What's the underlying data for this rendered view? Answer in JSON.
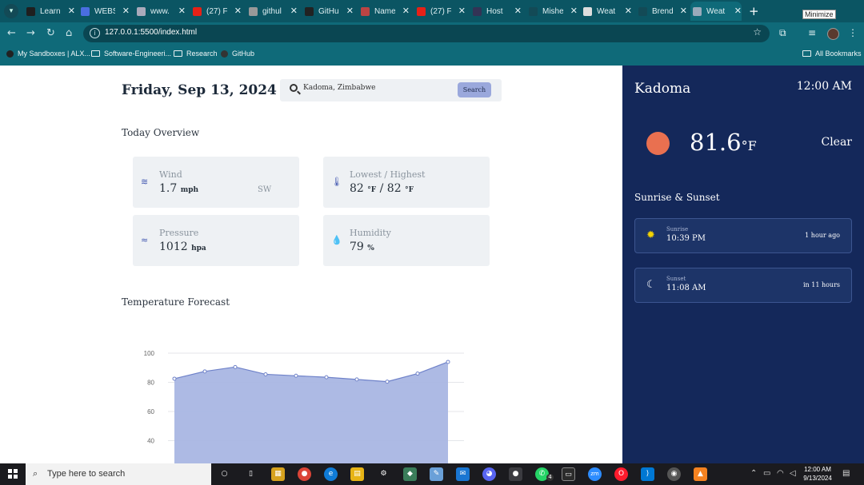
{
  "browser": {
    "tabs": [
      {
        "title": "Learn",
        "color": "#1f1f1f"
      },
      {
        "title": "WEBS",
        "color": "#4a6ee0"
      },
      {
        "title": "www.",
        "color": "#aab"
      },
      {
        "title": "(27) F",
        "color": "#e62117"
      },
      {
        "title": "githul",
        "color": "#999"
      },
      {
        "title": "GitHu",
        "color": "#222"
      },
      {
        "title": "Name",
        "color": "#b44"
      },
      {
        "title": "(27) F",
        "color": "#e62117"
      },
      {
        "title": "Host",
        "color": "#335"
      },
      {
        "title": "Mishe",
        "color": "#134a56"
      },
      {
        "title": "Weat",
        "color": "#ddd"
      },
      {
        "title": "Brend",
        "color": "#134a56"
      },
      {
        "title": "Weat",
        "color": "#9ab"
      }
    ],
    "tooltip": "Minimize",
    "url": "127.0.0.1:5500/index.html",
    "bookmarks": [
      "My Sandboxes | ALX...",
      "Software-Engineeri...",
      "Research",
      "GitHub"
    ],
    "all_bookmarks": "All Bookmarks"
  },
  "main": {
    "date": "Friday, Sep 13, 2024",
    "search": {
      "value": "Kadoma, Zimbabwe",
      "button": "Search"
    },
    "overview_title": "Today Overview",
    "cards": {
      "wind": {
        "label": "Wind",
        "value": "1.7",
        "unit": "mph",
        "direction": "SW"
      },
      "lowhigh": {
        "label": "Lowest / Highest",
        "low": "82",
        "high": "82",
        "unit": "°F"
      },
      "pressure": {
        "label": "Pressure",
        "value": "1012",
        "unit": "hpa"
      },
      "humidity": {
        "label": "Humidity",
        "value": "79",
        "unit": "%"
      }
    },
    "forecast_title": "Temperature Forecast"
  },
  "chart_data": {
    "type": "area",
    "x": [
      1,
      2,
      3,
      4,
      5,
      6,
      7,
      8,
      9,
      10
    ],
    "values": [
      82.5,
      87.5,
      90.5,
      85.5,
      84.5,
      83.5,
      82,
      80.5,
      86,
      94
    ],
    "yticks": [
      40,
      60,
      80,
      100
    ],
    "ylim": [
      30,
      100
    ],
    "fill": "#a9b6e3",
    "stroke": "#6f82c9"
  },
  "side": {
    "city": "Kadoma",
    "time": "12:00 AM",
    "temp": "81.6",
    "temp_unit": "°F",
    "condition": "Clear",
    "ss_title": "Sunrise & Sunset",
    "sunrise": {
      "label": "Sunrise",
      "time": "10:39 PM",
      "relative": "1 hour ago"
    },
    "sunset": {
      "label": "Sunset",
      "time": "11:08 AM",
      "relative": "in 11 hours"
    }
  },
  "taskbar": {
    "search_placeholder": "Type here to search",
    "time": "12:00 AM",
    "date": "9/13/2024",
    "badge": "4"
  }
}
